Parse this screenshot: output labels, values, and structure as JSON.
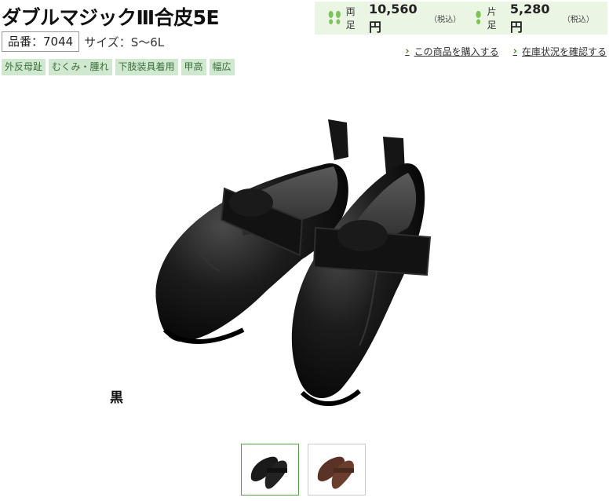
{
  "product": {
    "title": "ダブルマジックⅢ合皮5E",
    "code": "品番：7044",
    "size": "サイズ：S〜6L",
    "tags": [
      "外反母趾",
      "むくみ・腫れ",
      "下肢装具着用",
      "甲高",
      "幅広"
    ]
  },
  "price": {
    "pair_label": "両足",
    "pair_value": "10,560円",
    "single_label": "片足",
    "single_value": "5,280円",
    "tax_note": "（税込）"
  },
  "links": {
    "buy": "この商品を購入する",
    "stock": "在庫状況を確認する"
  },
  "gallery": {
    "color_label": "黒",
    "thumbnails": [
      "black",
      "brown"
    ]
  },
  "colors": {
    "accent": "#4a8a2e",
    "price_bg": "#eaf5e4",
    "tag_bg": "#cfe8cf"
  }
}
